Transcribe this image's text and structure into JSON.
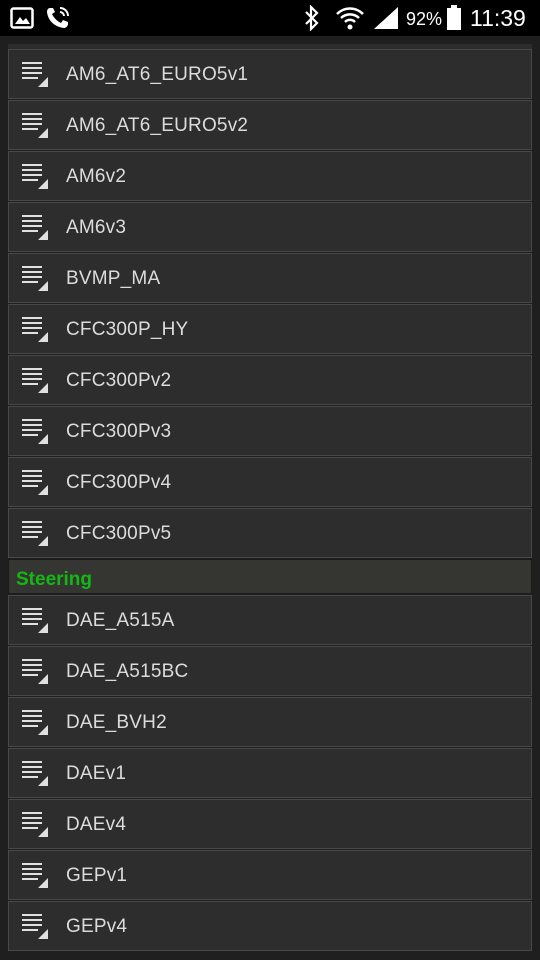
{
  "status_bar": {
    "battery_percent": "92%",
    "time": "11:39",
    "icons": [
      "gallery-icon",
      "call-icon",
      "bluetooth-icon",
      "wifi-icon",
      "signal-icon",
      "battery-icon"
    ]
  },
  "groups": [
    {
      "header": "",
      "items": [
        "AM6_AT6_EURO5v1",
        "AM6_AT6_EURO5v2",
        "AM6v2",
        "AM6v3",
        "BVMP_MA",
        "CFC300P_HY",
        "CFC300Pv2",
        "CFC300Pv3",
        "CFC300Pv4",
        "CFC300Pv5"
      ]
    },
    {
      "header": "Steering",
      "items": [
        "DAE_A515A",
        "DAE_A515BC",
        "DAE_BVH2",
        "DAEv1",
        "DAEv4",
        "GEPv1",
        "GEPv4"
      ]
    }
  ],
  "colors": {
    "header_text": "#14b814",
    "row_background": "#2d2d2d",
    "page_background": "#1f1f1f"
  }
}
